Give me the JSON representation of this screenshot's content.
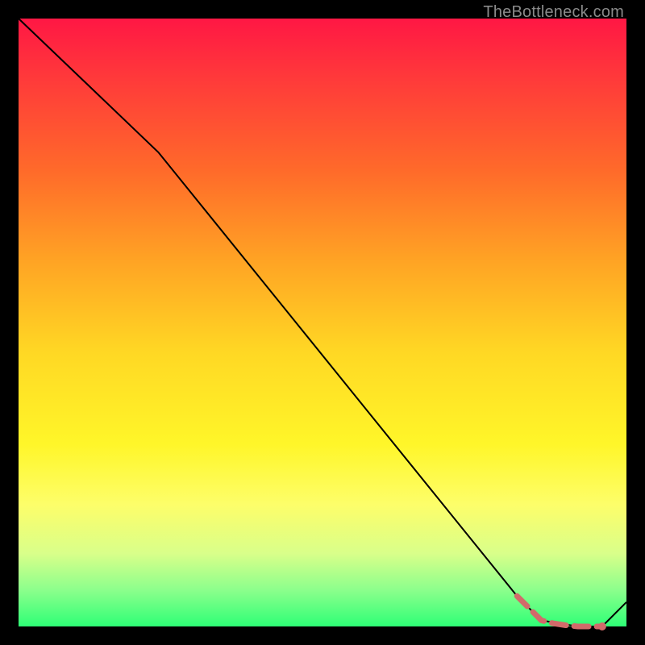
{
  "watermark": "TheBottleneck.com",
  "chart_data": {
    "type": "line",
    "title": "",
    "xlabel": "",
    "ylabel": "",
    "xlim": [
      0,
      100
    ],
    "ylim": [
      0,
      100
    ],
    "series": [
      {
        "name": "main-curve",
        "color": "#000000",
        "stroke_width": 2,
        "x": [
          0,
          23,
          82,
          86,
          92,
          96,
          100
        ],
        "values": [
          100,
          78,
          5,
          1,
          0,
          0,
          4
        ]
      },
      {
        "name": "highlight-segment",
        "color": "#d26a6a",
        "stroke_width": 7,
        "dash": "18 10",
        "linecap": "round",
        "x": [
          82,
          84.5,
          86,
          88,
          90,
          92,
          94,
          96
        ],
        "values": [
          5,
          2.5,
          1,
          0.5,
          0.2,
          0,
          0,
          0
        ]
      },
      {
        "name": "highlight-end-dot",
        "type_hint": "scatter",
        "color": "#d26a6a",
        "radius": 5,
        "x": [
          96
        ],
        "values": [
          0
        ]
      }
    ]
  }
}
